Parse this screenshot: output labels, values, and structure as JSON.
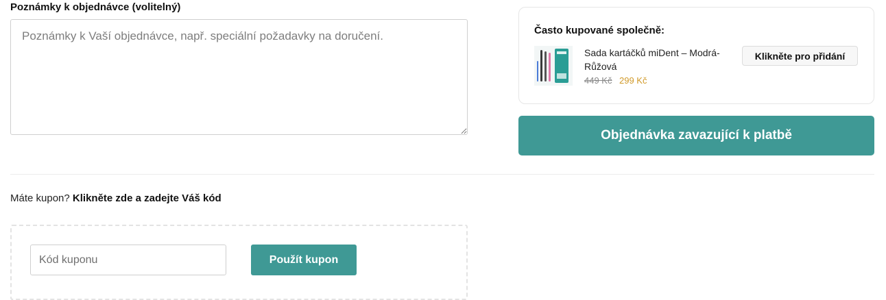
{
  "notes": {
    "label": "Poznámky k objednávce (volitelný)",
    "placeholder": "Poznámky k Vaší objednávce, např. speciální požadavky na doručení.",
    "value": ""
  },
  "coupon": {
    "prompt_text": "Máte kupon?",
    "prompt_link": "Klikněte zde a zadejte Váš kód",
    "input_placeholder": "Kód kuponu",
    "input_value": "",
    "apply_label": "Použít kupon"
  },
  "frequently_bought": {
    "title": "Často kupované společně:",
    "product": {
      "name": "Sada kartáčků miDent – Modrá-Růžová",
      "price_old": "449 Kč",
      "price_new": "299 Kč",
      "image_icon": "toothbrush-set-image"
    },
    "add_label": "Klikněte pro přidání"
  },
  "order_button_label": "Objednávka zavazující k platbě",
  "colors": {
    "accent": "#3f9995",
    "price_new": "#d19a2a"
  }
}
